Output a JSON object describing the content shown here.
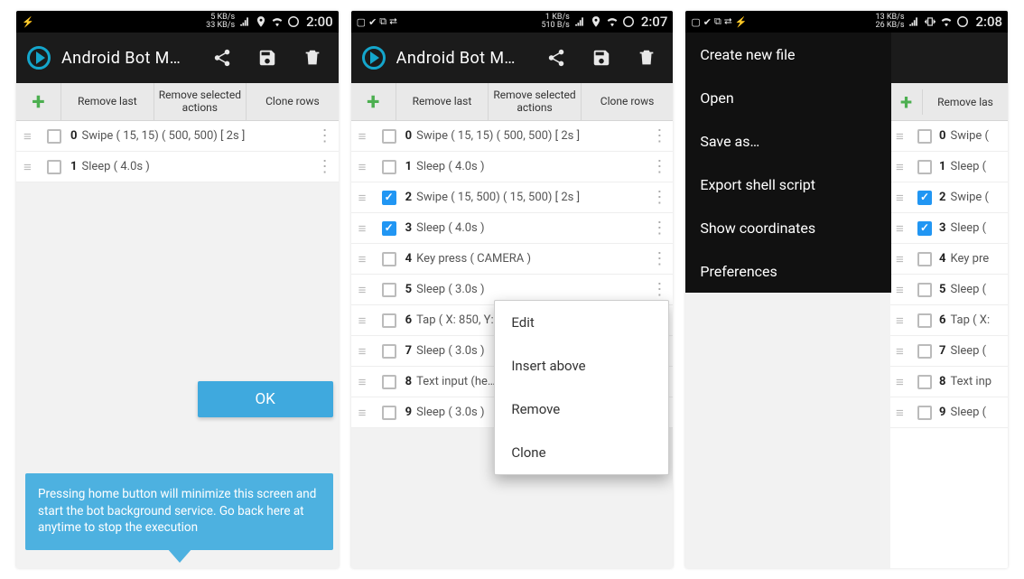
{
  "status": {
    "s1": {
      "kb": "5 KB/s\n33 KB/s",
      "time": "2:00",
      "left": [
        "bolt"
      ]
    },
    "s2": {
      "kb": "1 KB/s\n510 B/s",
      "time": "2:07",
      "left": [
        "image",
        "check",
        "copy",
        "link"
      ]
    },
    "s3": {
      "kb": "13 KB/s\n26 KB/s",
      "time": "2:08",
      "left": [
        "image",
        "check",
        "copy",
        "link",
        "bolt"
      ]
    }
  },
  "app_title": "Android Bot M…",
  "toolbar": {
    "remove_last": "Remove last",
    "remove_selected": "Remove selected actions",
    "clone": "Clone rows"
  },
  "s1_rows": [
    {
      "idx": "0",
      "text": "Swipe ( 15, 15)  ( 500, 500)  [ 2s ]",
      "checked": false
    },
    {
      "idx": "1",
      "text": "Sleep ( 4.0s )",
      "checked": false
    }
  ],
  "s2_rows": [
    {
      "idx": "0",
      "text": "Swipe ( 15, 15)  ( 500, 500)  [ 2s ]",
      "checked": false
    },
    {
      "idx": "1",
      "text": "Sleep ( 4.0s )",
      "checked": false
    },
    {
      "idx": "2",
      "text": "Swipe ( 15, 500)  ( 15, 500)  [ 2s ]",
      "checked": true
    },
    {
      "idx": "3",
      "text": "Sleep ( 4.0s )",
      "checked": true
    },
    {
      "idx": "4",
      "text": "Key press ( CAMERA )",
      "checked": false
    },
    {
      "idx": "5",
      "text": "Sleep ( 3.0s )",
      "checked": false
    },
    {
      "idx": "6",
      "text": "Tap ( X: 850, Y: …",
      "checked": false
    },
    {
      "idx": "7",
      "text": "Sleep ( 3.0s )",
      "checked": false
    },
    {
      "idx": "8",
      "text": "Text input (he…",
      "checked": false
    },
    {
      "idx": "9",
      "text": "Sleep ( 3.0s )",
      "checked": false
    }
  ],
  "s3_rows": [
    {
      "idx": "0",
      "text": "Swipe (",
      "checked": false
    },
    {
      "idx": "1",
      "text": "Sleep (",
      "checked": false
    },
    {
      "idx": "2",
      "text": "Swipe (",
      "checked": true
    },
    {
      "idx": "3",
      "text": "Sleep (",
      "checked": true
    },
    {
      "idx": "4",
      "text": "Key pre",
      "checked": false
    },
    {
      "idx": "5",
      "text": "Sleep (",
      "checked": false
    },
    {
      "idx": "6",
      "text": "Tap ( X:",
      "checked": false
    },
    {
      "idx": "7",
      "text": "Sleep (",
      "checked": false
    },
    {
      "idx": "8",
      "text": "Text inp",
      "checked": false
    },
    {
      "idx": "9",
      "text": "Sleep (",
      "checked": false
    }
  ],
  "ok_label": "OK",
  "tip_text": "Pressing home button will minimize this screen and start the bot background service. Go back here at anytime to stop the execution",
  "ctx_menu": [
    "Edit",
    "Insert above",
    "Remove",
    "Clone"
  ],
  "overflow_menu": [
    "Create new file",
    "Open",
    "Save as…",
    "Export shell script",
    "Show coordinates",
    "Preferences"
  ],
  "sliver_tb": "Remove las"
}
